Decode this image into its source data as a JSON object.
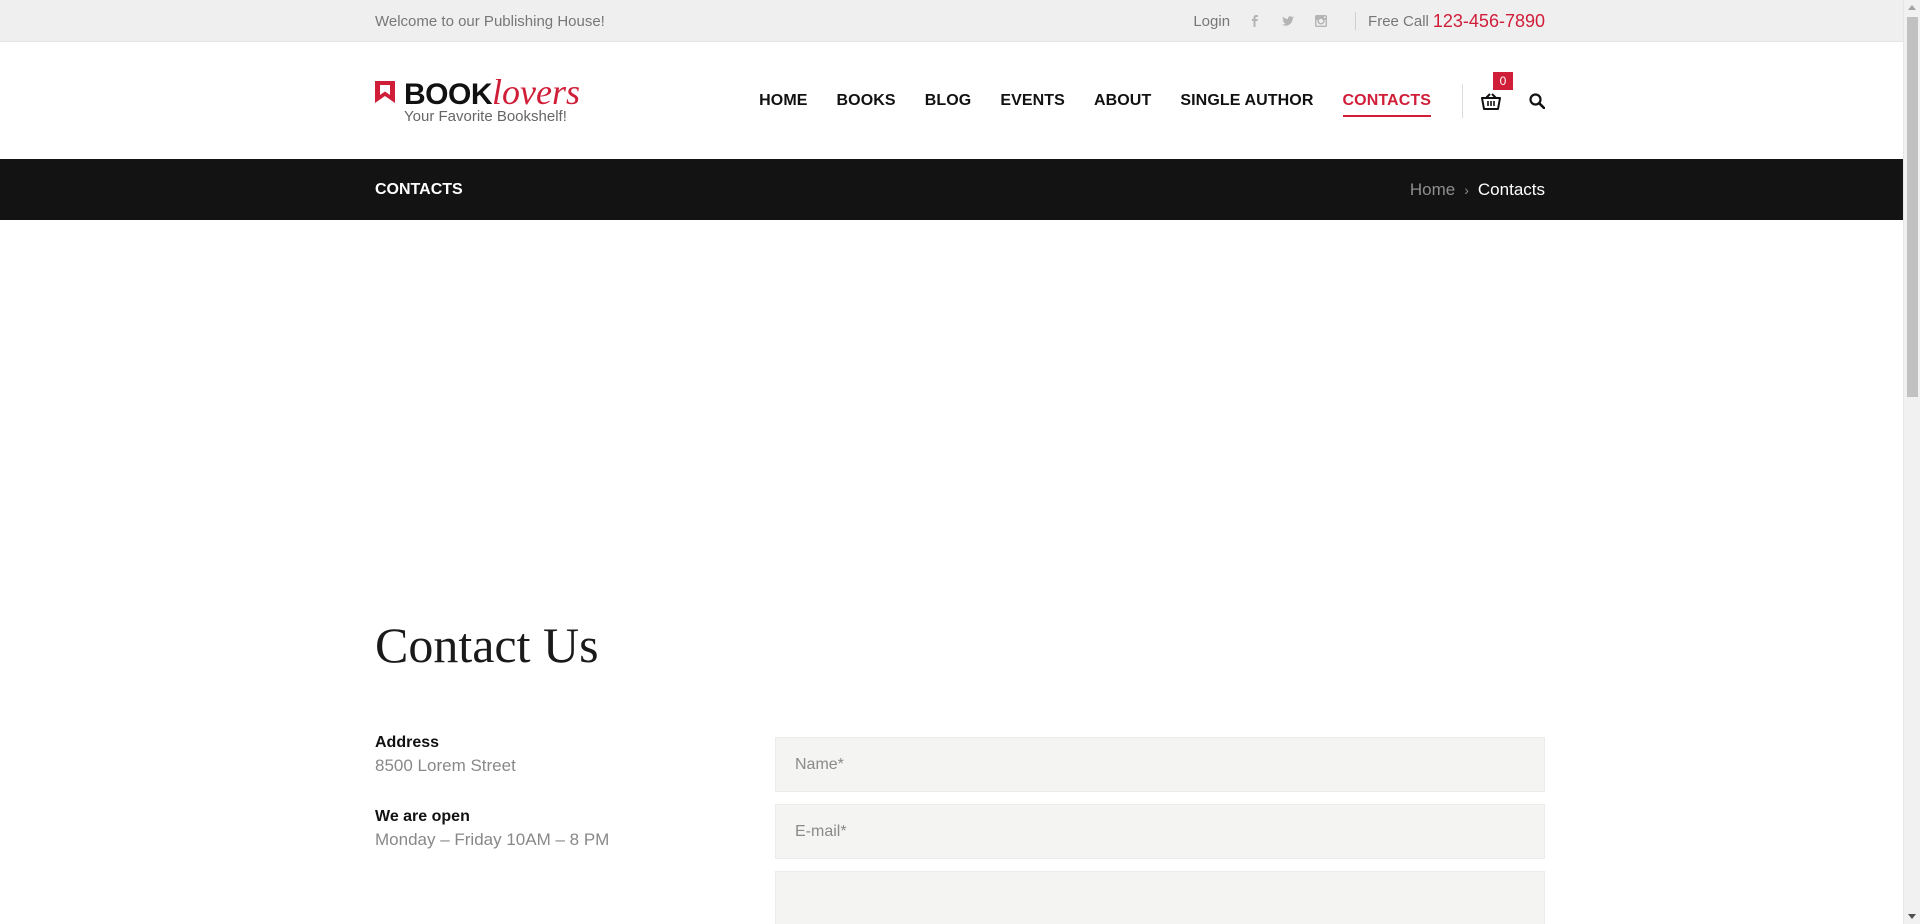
{
  "topbar": {
    "welcome": "Welcome to our Publishing House!",
    "login": "Login",
    "social": [
      "facebook-icon",
      "twitter-icon",
      "instagram-icon"
    ],
    "free_call_label": "Free Call",
    "phone": "123-456-7890"
  },
  "logo": {
    "book": "BOOK",
    "lovers": "lovers",
    "tagline": "Your Favorite Bookshelf!"
  },
  "nav": {
    "items": [
      "HOME",
      "BOOKS",
      "BLOG",
      "EVENTS",
      "ABOUT",
      "SINGLE AUTHOR",
      "CONTACTS"
    ],
    "active": "CONTACTS",
    "cart_count": "0"
  },
  "titlebar": {
    "title": "CONTACTS",
    "breadcrumb_home": "Home",
    "breadcrumb_current": "Contacts"
  },
  "contact": {
    "heading": "Contact Us",
    "address_label": "Address",
    "address_value": "8500 Lorem Street",
    "hours_label": "We are open",
    "hours_value": "Monday – Friday 10AM – 8 PM",
    "name_placeholder": "Name*",
    "email_placeholder": "E-mail*"
  },
  "colors": {
    "accent": "#d01d38",
    "titlebar_bg": "#131313",
    "topbar_bg": "#efefef"
  }
}
